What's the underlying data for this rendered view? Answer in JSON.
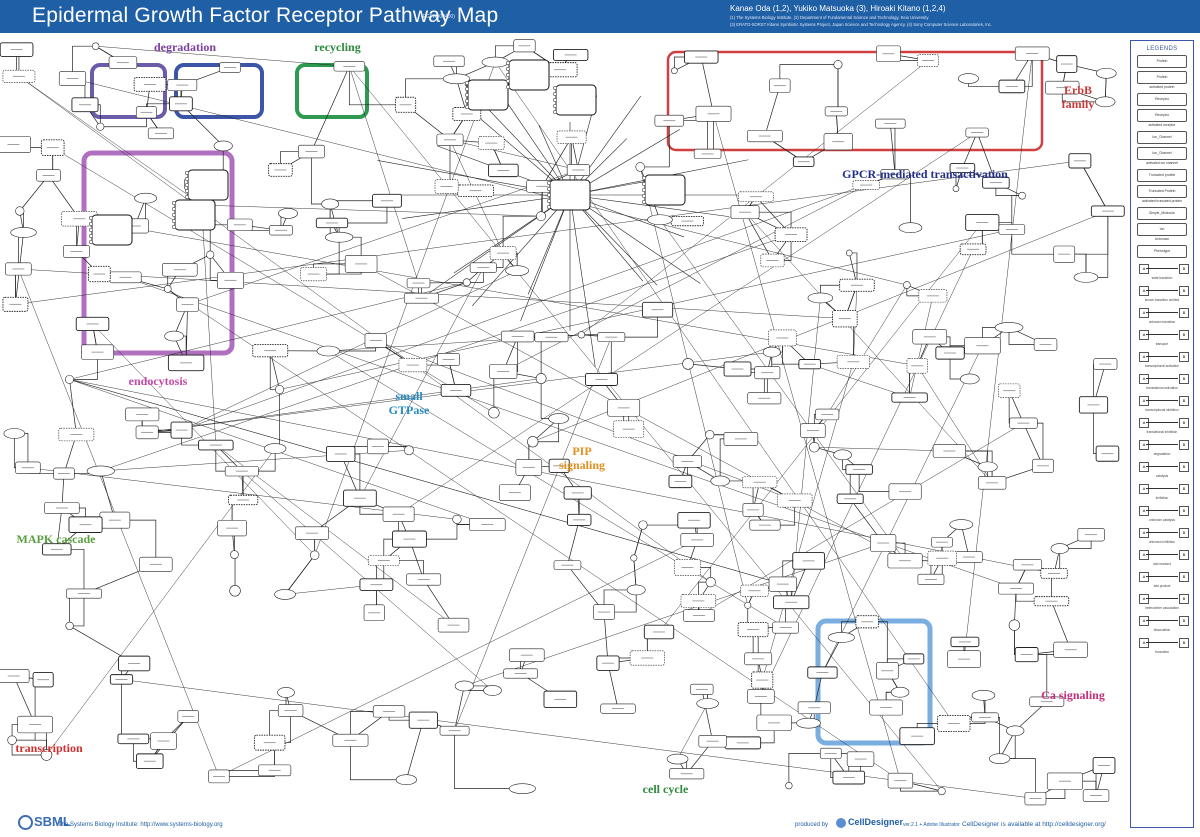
{
  "header": {
    "title": "Epidermal Growth Factor Receptor Pathway Map",
    "code": "(EGFR000400)",
    "authors": "Kanae Oda (1,2), Yukiko Matsuoka (3), Hiroaki Kitano (1,2,4)",
    "affiliations": [
      "(1) The Systems Biology Institute, (2) Department of Fundamental Science and Technology, Keio University",
      "(3) ERATO-SORST Kitano Symbiotic Systems Project, Japan Science and Technology Agency, (4) Sony Computer Science Laboratories, Inc."
    ]
  },
  "regions": {
    "degradation": "degradation",
    "recycling": "recycling",
    "erbb_family": "ErbB family",
    "gpcr": "GPCR-mediated transactivation",
    "endocytosis": "endocytosis",
    "small_gtpase": "small GTPase",
    "pip_signaling": "PIP signaling",
    "mapk_cascade": "MAPK cascade",
    "ca_signaling": "Ca signaling",
    "transcription": "transcription",
    "cell_cycle": "cell cycle"
  },
  "colors": {
    "header": "#1f5fa6",
    "degradation_box": "#6b5ba8",
    "degradation_box2": "#3d55a6",
    "recycling_box": "#2e9a4f",
    "erbb_box": "#d04040",
    "endocytosis_box": "#b070c0",
    "ca_box": "#7aaee0",
    "degradation_text": "#7a3fa0",
    "recycling_text": "#2e8a3f",
    "erbb_text": "#c83a3a",
    "gpcr_text": "#23308a",
    "endocytosis_text": "#c44aa8",
    "gtpase_text": "#2a8ac0",
    "pip_text": "#e09020",
    "mapk_text": "#5aa040",
    "ca_text": "#c0307a",
    "transcription_text": "#d03030",
    "cellcycle_text": "#2e8a3f"
  },
  "legend": {
    "title": "LEGENDS",
    "node_types": [
      "Protein",
      "Protein",
      "activated protein",
      "Receptor",
      "Receptor",
      "activated receptor",
      "Ion_Channel",
      "Ion_Channel",
      "activated ion channel",
      "Truncated protein",
      "Truncated Protein",
      "activated truncated protein",
      "Simple_Molecule",
      "Ion",
      "Unknown",
      "Phenotype"
    ],
    "edge_types": [
      "state transition",
      "known transition omitted",
      "unknown transition",
      "transport",
      "transcriptional activation",
      "translational activation",
      "transcriptional inhibition",
      "translational inhibition",
      "degradation",
      "catalysis",
      "inhibition",
      "unknown catalysis",
      "unknown inhibition",
      "add reactant",
      "add product",
      "heterodimer association",
      "dissociation",
      "truncation"
    ]
  },
  "footer": {
    "sbml_logo": "SBML",
    "sbi_text": "The Systems Biology Institute: http://www.systems-biology.org",
    "produced_by": "produced by",
    "celldesigner_logo": "CellDesigner",
    "version_text": "ver.2.1 + Adobe Illustrator",
    "available_text": "CellDesigner is available at http://celldesigner.org/"
  }
}
